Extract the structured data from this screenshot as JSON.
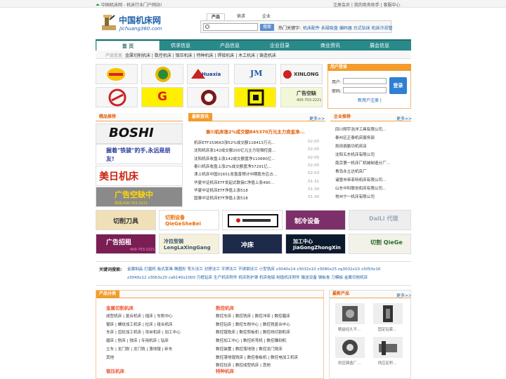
{
  "topbar": {
    "left": "中国机床网 - 机床行业门户网站!",
    "right": "注册会员 | 我的商务助手 | 客服中心"
  },
  "logo": {
    "name": "中国机床网",
    "domain": "Jichuang360.com"
  },
  "search": {
    "tabs": [
      "产品",
      "供求",
      "企业"
    ],
    "placeholder": "",
    "button": "搜索",
    "hot_label": "热门关键字:",
    "hot_words": "机床配件 永磁吸盘 编码器 台式钻床 机床冷却管"
  },
  "nav": {
    "items": [
      "首 页",
      "供求信息",
      "产品信息",
      "企业目录",
      "商业资讯",
      "展会信息"
    ],
    "sub_label": "产品信息",
    "sub_links": "金属切削机床 | 数控机床 | 锻压机床 | 特种机床 | 焊接机床 | 木工机床 | 铸造机床"
  },
  "logos": [
    {
      "id": "logo-1",
      "text": "",
      "bg": "#f6f6f6"
    },
    {
      "id": "logo-2",
      "text": "",
      "bg": "#f6f6f6"
    },
    {
      "id": "logo-3",
      "text": "Huaxia",
      "bg": "#f6f6f6"
    },
    {
      "id": "logo-4",
      "text": "JM",
      "bg": "#f6f6f6"
    },
    {
      "id": "logo-5",
      "text": "XINLONG",
      "bg": "#f6f6f6"
    },
    {
      "id": "logo-6",
      "text": "",
      "bg": "#f6f6f6"
    },
    {
      "id": "logo-7",
      "text": "G",
      "bg": "#ffef00"
    },
    {
      "id": "logo-8",
      "text": "",
      "bg": "#f6f6f6"
    },
    {
      "id": "logo-9",
      "text": "",
      "bg": "#ffef00"
    },
    {
      "id": "logo-10",
      "text": "广告空缺",
      "bg": "#f6f6f6"
    }
  ],
  "login": {
    "title": "用户登录",
    "user_label": "用户:",
    "pass_label": "密码:",
    "button": "登录",
    "links": "新用户注册 |"
  },
  "featured": {
    "title": "精品推荐",
    "more": "更多>>",
    "banners": [
      "BOSHI",
      "握着\"铁骏\"的手,永远是朋友!",
      "美日机床",
      "广告空缺中"
    ]
  },
  "news": {
    "title": "最新资讯",
    "more": "更多>>",
    "headline": "泰川机床涨2%成交额845370万元主力资金净...",
    "items": [
      {
        "t": "机床ETF159663涨52%成交额118413万元...",
        "d": "02-05"
      },
      {
        "t": "沈阳机床涨142成交额200亿元主力轻微控盘...",
        "d": "02-05"
      },
      {
        "t": "沈阳机床收盘上涨142成交额盘净110680亿...",
        "d": "02-05"
      },
      {
        "t": "泰川机床收盘上涨2%成交额盘净57291亿...",
        "d": "02-05"
      },
      {
        "t": "津上机床中国01651发盈喜预计中期股东应占...",
        "d": "02-03"
      },
      {
        "t": "华夏中证机床ETF发起式联接C净值上涨490...",
        "d": "01-31"
      },
      {
        "t": "华夏中证机床ETF净值上涨518",
        "d": "01-30"
      },
      {
        "t": "国泰中证机床ETF净值上涨518",
        "d": "01-30"
      }
    ]
  },
  "companies": {
    "title": "企业推荐",
    "more": "更多>>",
    "items": [
      "四川翔宇浩洋工具有限公司...",
      "泰州区正泰机床服务部",
      "和田县勤功机床店",
      "沈阳五东机床有限公司",
      "南京第一机床厂机械制造分厂...",
      "青岛永立达机床厂",
      "诸暨市帝菲特机床有限公司...",
      "山东中科联创机床有限公司...",
      "常州宁一机床有限公司"
    ]
  },
  "adbanners": [
    {
      "text": "切削刀具",
      "bg": "#f0e0b8"
    },
    {
      "text": "切割设备 QieGeSheBei",
      "bg": "#ffffff"
    },
    {
      "text": "",
      "bg": "#ffffff"
    },
    {
      "text": "制冷设备",
      "bg": "#7d2f6a"
    },
    {
      "text": "DaiLi 代理",
      "bg": "#eeeeee"
    },
    {
      "text": "广告招租",
      "bg": "#7a1e54"
    },
    {
      "text": "冷拉型钢 LengLaXingGang",
      "bg": "#f4f0dc"
    },
    {
      "text": "冲床",
      "bg": "#1e2a4a"
    },
    {
      "text": "加工中心 JiaGongZhongXin",
      "bg": "#0d1a2e"
    },
    {
      "text": "切割 QieGe",
      "bg": "#f2f2e8"
    }
  ],
  "keywords": {
    "label": "关键词搜索:",
    "line1": "金属制品  打磨机  板式家具  椭圆形  弯头法兰  对焊法兰  平焊法兰  不锈钢法兰  小型铣床  z3040x14  z3032x10  z3080x25  zq3032x10  z3050x16",
    "line2": "z3040x12  z3063x20  ca6140x1000  万框钻床  生产机床附件  机床防护罩  机床拖链  制造机床附件  输送设备  钢板卷  刀模板  金属切削机床"
  },
  "categories": {
    "title": "产品分类",
    "groups": [
      {
        "name": "金属切削机床",
        "lines": [
          "成型机床 | 复合机床 | 插床 | 车削中心",
          "锯床 | 螺纹加工机床 | 拉床 | 组合机床",
          "车床 | 齿轮加工机床 | 攻丝机床 | 加工中心",
          "磨床 | 刨床 | 铣床 | 专用机床 | 钻床",
          "立车 | 龙门刨 | 龙门铣 | 落地镗 | 卧车",
          "其他"
        ]
      },
      {
        "name": "数控机床",
        "lines": [
          "数控车床 | 数控铣床 | 数控冲床 | 数控磨床",
          "数控钻床 | 数控车削中心 | 数控铣复合中心",
          "数控镗铣床 | 数控剪板机 | 数控线切割机床",
          "数控加工中心 | 数控折弯机 | 数控雕刻机",
          "数控装置 | 数控落地铣 | 数控龙门铣床",
          "数控落地镗铣床 | 数控卷板机 | 数控电加工机床",
          "数控拉床 | 数控成型机床 | 其他"
        ]
      },
      {
        "name": "锻压机床",
        "lines": []
      },
      {
        "name": "特种机床",
        "lines": []
      }
    ]
  },
  "products": {
    "title": "最新产品",
    "more": "更多>>",
    "items": [
      "精益经久不...",
      "固定钻套...",
      "供应铸造厂...",
      "供应定积..."
    ]
  }
}
